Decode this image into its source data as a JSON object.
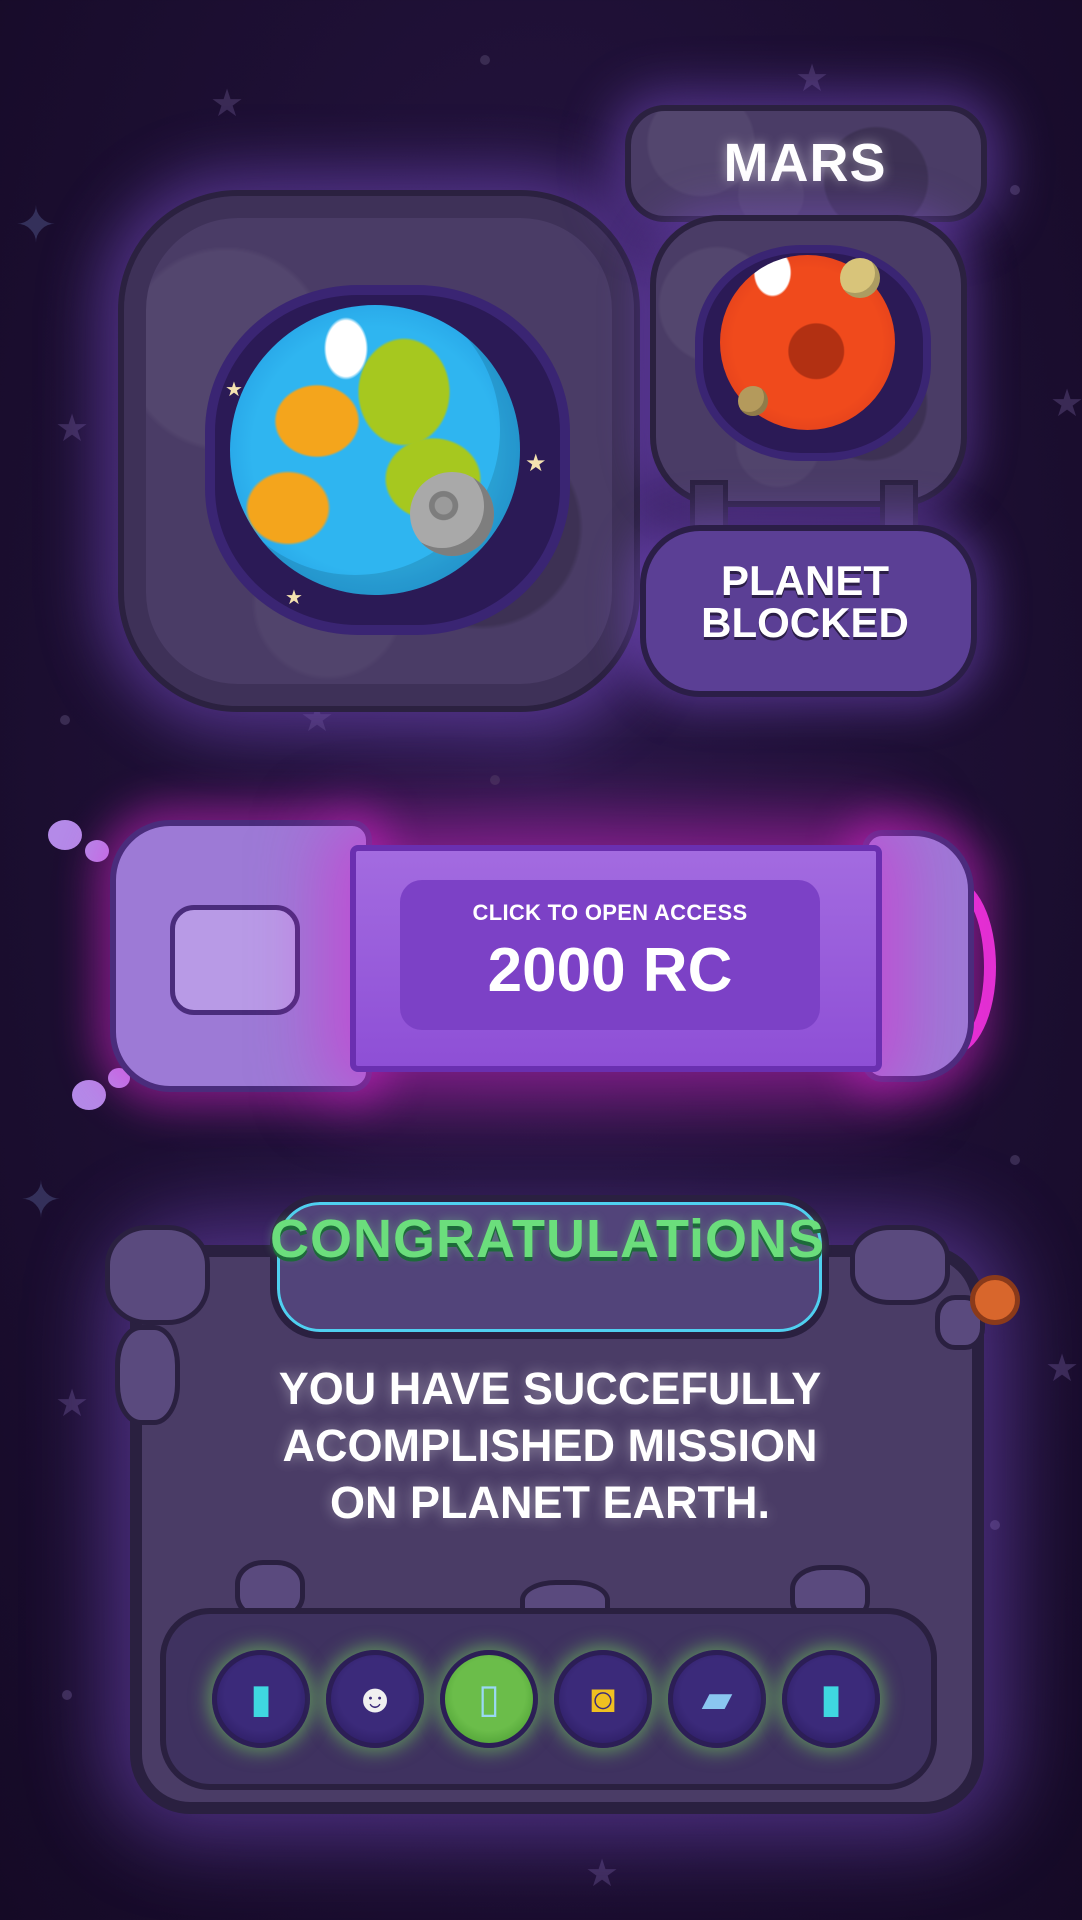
{
  "mars_card": {
    "title": "MARS",
    "status": "PLANET BLOCKED"
  },
  "access": {
    "label": "CLICK TO OPEN ACCESS",
    "price": "2000 RC"
  },
  "congrats": {
    "title": "CONGRATULATiONS",
    "message_lines": [
      "YOU HAVE SUCCEFULLY",
      "ACOMPLISHED MISSION",
      "ON PLANET EARTH."
    ]
  },
  "rewards": [
    {
      "icon": "oxygen-tank-icon"
    },
    {
      "icon": "astronaut-helmet-icon"
    },
    {
      "icon": "water-bottles-icon"
    },
    {
      "icon": "space-food-can-icon"
    },
    {
      "icon": "solar-panel-icon"
    },
    {
      "icon": "flashlight-icon"
    }
  ],
  "colors": {
    "background": "#1d0f33",
    "stone": "#4a3c66",
    "glow_purple": "#8c5ae6",
    "glow_pink": "#e133d0",
    "title_green": "#6bde7c"
  }
}
